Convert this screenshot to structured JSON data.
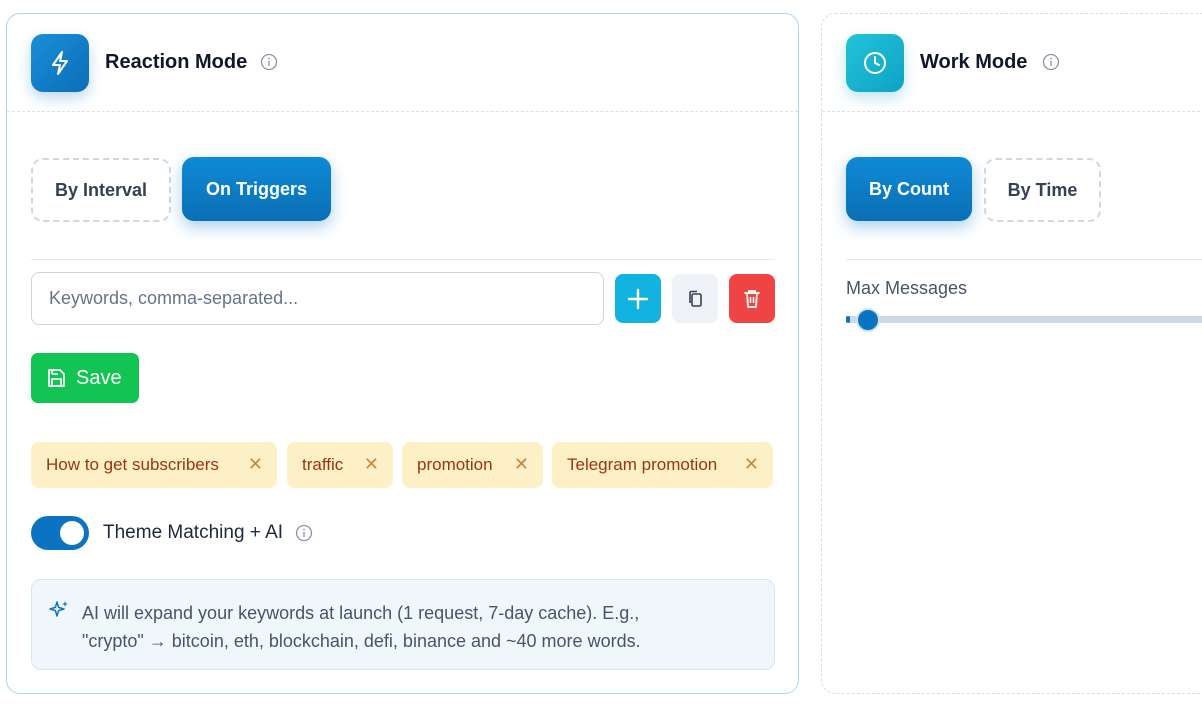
{
  "reaction": {
    "title": "Reaction Mode",
    "tabs": [
      {
        "label": "By Interval",
        "active": false
      },
      {
        "label": "On Triggers",
        "active": true
      }
    ],
    "keyword_input": {
      "placeholder": "Keywords, comma-separated...",
      "value": ""
    },
    "buttons": {
      "add_icon": "plus-icon",
      "copy_icon": "copy-icon",
      "delete_icon": "trash-icon"
    },
    "save_label": "Save",
    "tags": [
      "How to get subscribers",
      "traffic",
      "promotion",
      "Telegram promotion"
    ],
    "theme_matching": {
      "label": "Theme Matching + AI",
      "enabled": true
    },
    "ai_note": {
      "line1": "AI will expand your keywords at launch (1 request, 7-day cache). E.g.,",
      "line2": "\"crypto\" → bitcoin, eth, blockchain, defi, binance and ~40 more words."
    }
  },
  "work": {
    "title": "Work Mode",
    "tabs": [
      {
        "label": "By Count",
        "active": true
      },
      {
        "label": "By Time",
        "active": false
      }
    ],
    "max_messages": {
      "label": "Max Messages",
      "value_fraction": 0.01
    }
  },
  "colors": {
    "accent": "#0b74c2",
    "save": "#12c552",
    "delete": "#ef4444",
    "add": "#12b3e0",
    "tag_bg": "#fdf0c6",
    "tag_text": "#9a3412"
  }
}
